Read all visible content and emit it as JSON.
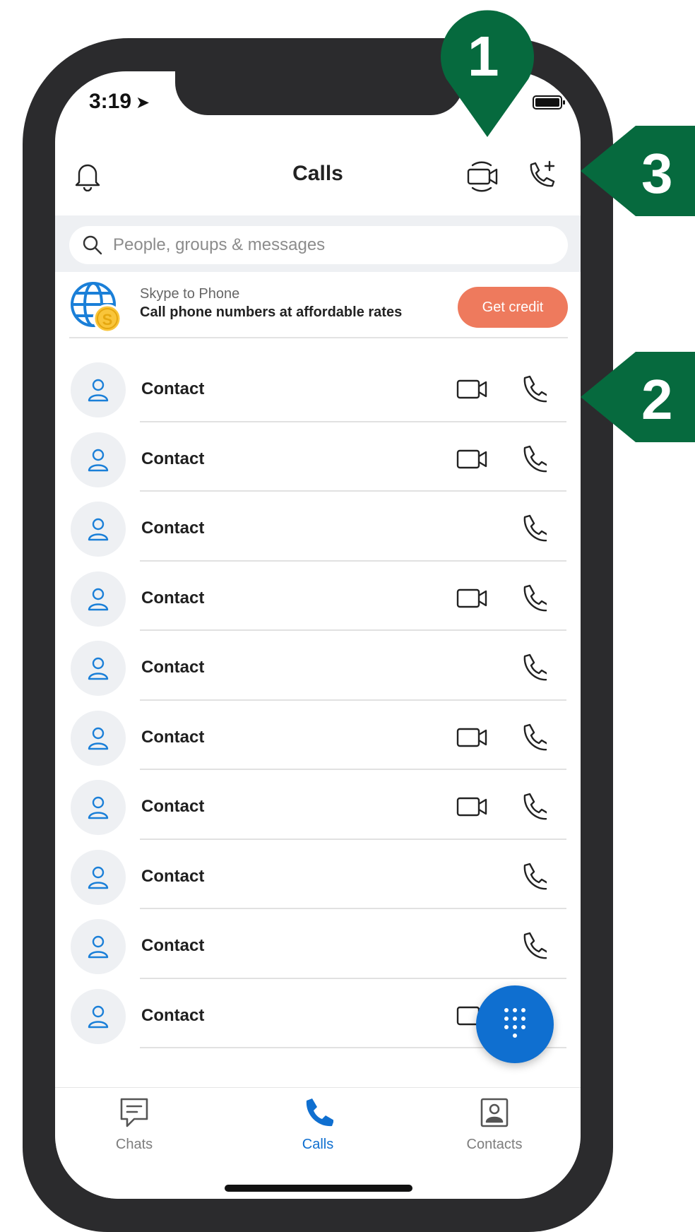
{
  "status_bar": {
    "time": "3:19",
    "location_glyph": "➤"
  },
  "header": {
    "title": "Calls"
  },
  "search": {
    "placeholder": "People, groups & messages",
    "value": ""
  },
  "promo": {
    "subtitle": "Skype to Phone",
    "message": "Call phone numbers at affordable rates",
    "button_label": "Get credit"
  },
  "contacts": [
    {
      "name": "Contact",
      "video": true
    },
    {
      "name": "Contact",
      "video": true
    },
    {
      "name": "Contact",
      "video": false
    },
    {
      "name": "Contact",
      "video": true
    },
    {
      "name": "Contact",
      "video": false
    },
    {
      "name": "Contact",
      "video": true
    },
    {
      "name": "Contact",
      "video": true
    },
    {
      "name": "Contact",
      "video": false
    },
    {
      "name": "Contact",
      "video": false
    },
    {
      "name": "Contact",
      "video": true
    }
  ],
  "tabs": [
    {
      "label": "Chats",
      "icon": "chat-icon",
      "active": false
    },
    {
      "label": "Calls",
      "icon": "phone-icon",
      "active": true
    },
    {
      "label": "Contacts",
      "icon": "contact-card-icon",
      "active": false
    }
  ],
  "callouts": [
    {
      "number": "1",
      "target": "new-meeting"
    },
    {
      "number": "2",
      "target": "contact-row"
    },
    {
      "number": "3",
      "target": "new-call"
    }
  ],
  "colors": {
    "accent": "#0f6fd0",
    "promo_button": "#ee7a5d",
    "callout": "#066a3e",
    "frame": "#2b2b2d"
  }
}
